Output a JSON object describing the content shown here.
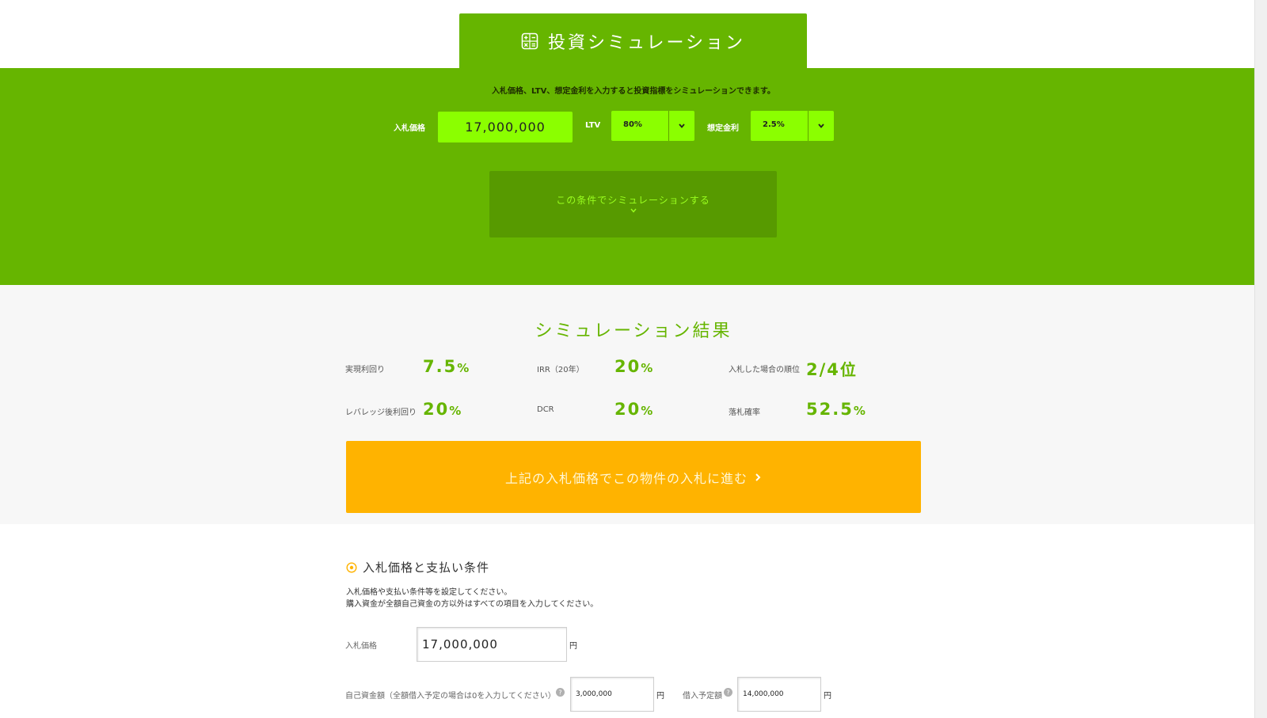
{
  "header": {
    "title": "投資シミュレーション",
    "icon": "calculator-icon"
  },
  "simulator": {
    "description": "入札価格、LTV、想定金利を入力すると投資指標をシミュレーションできます。",
    "bid_price_label": "入札価格",
    "bid_price_value": "17,000,000",
    "ltv_label": "LTV",
    "ltv_value": "80%",
    "rate_label": "想定金利",
    "rate_value": "2.5%",
    "simulate_button": "この条件でシミュレーションする"
  },
  "results": {
    "title": "シミュレーション結果",
    "metrics": [
      {
        "label": "実現利回り",
        "value": "7.5",
        "unit": "%"
      },
      {
        "label": "IRR（20年）",
        "value": "20",
        "unit": "%"
      },
      {
        "label": "入札した場合の順位",
        "value": "2/4",
        "unit": "位"
      },
      {
        "label": "レバレッジ後利回り",
        "value": "20",
        "unit": "%"
      },
      {
        "label": "DCR",
        "value": "20",
        "unit": "%"
      },
      {
        "label": "落札確率",
        "value": "52.5",
        "unit": "%"
      }
    ],
    "cta_button": "上記の入札価格でこの物件の入札に進む"
  },
  "conditions": {
    "heading": "入札価格と支払い条件",
    "desc_line1": "入札価格や支払い条件等を設定してください。",
    "desc_line2": "購入資金が全額自己資金の方以外はすべての項目を入力してください。",
    "bid_price_label": "入札価格",
    "bid_price_value": "17,000,000",
    "own_funds_label": "自己資金額（全額借入予定の場合は0を入力してください）",
    "own_funds_value": "3,000,000",
    "loan_label": "借入予定額",
    "loan_value": "14,000,000",
    "yen": "円"
  },
  "colors": {
    "brand_green": "#66b500",
    "input_green": "#8bff00",
    "cta_orange": "#ffb300",
    "background_gray": "#f7f7f7"
  }
}
